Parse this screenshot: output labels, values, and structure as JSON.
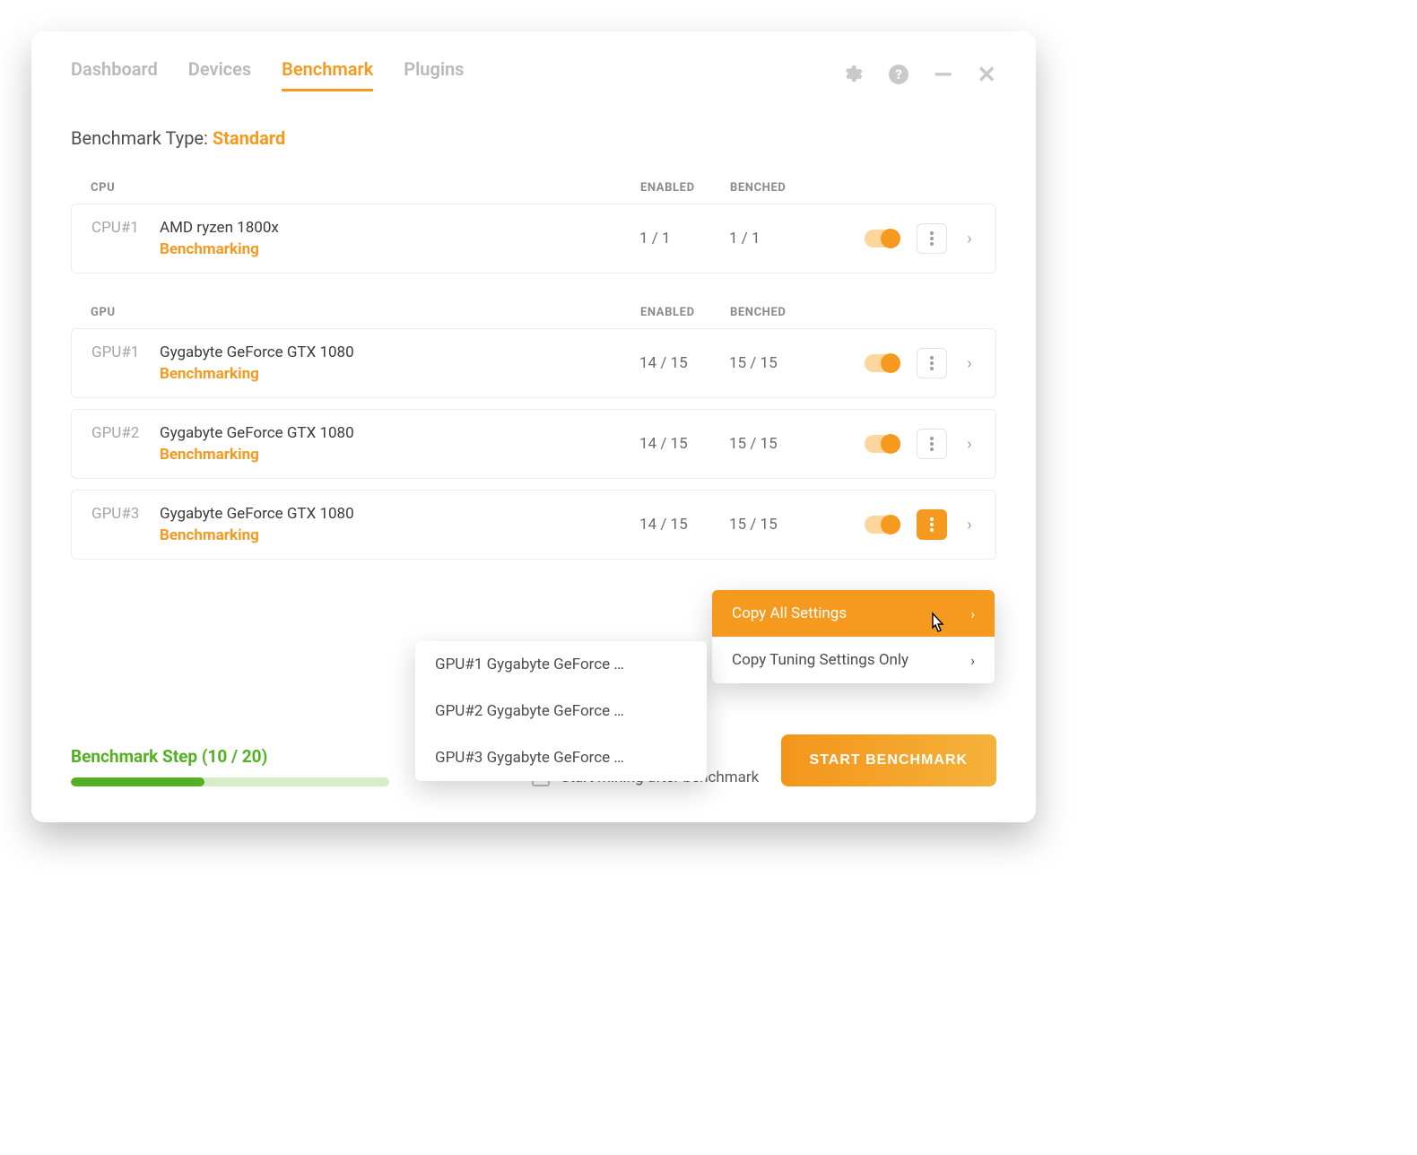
{
  "tabs": {
    "dashboard": "Dashboard",
    "devices": "Devices",
    "benchmark": "Benchmark",
    "plugins": "Plugins"
  },
  "bench_type": {
    "label": "Benchmark Type:",
    "value": "Standard"
  },
  "columns": {
    "enabled": "ENABLED",
    "benched": "BENCHED"
  },
  "cpu": {
    "header": "CPU",
    "rows": [
      {
        "id": "CPU#1",
        "name": "AMD ryzen 1800x",
        "state": "Benchmarking",
        "enabled": "1 / 1",
        "benched": "1 / 1"
      }
    ]
  },
  "gpu": {
    "header": "GPU",
    "rows": [
      {
        "id": "GPU#1",
        "name": "Gygabyte GeForce GTX 1080",
        "state": "Benchmarking",
        "enabled": "14 / 15",
        "benched": "15 / 15"
      },
      {
        "id": "GPU#2",
        "name": "Gygabyte GeForce GTX 1080",
        "state": "Benchmarking",
        "enabled": "14 / 15",
        "benched": "15 / 15"
      },
      {
        "id": "GPU#3",
        "name": "Gygabyte GeForce GTX 1080",
        "state": "Benchmarking",
        "enabled": "14 / 15",
        "benched": "15 / 15"
      }
    ]
  },
  "copy_menu": {
    "all": "Copy All Settings",
    "tuning": "Copy Tuning Settings Only"
  },
  "target_menu": {
    "t0": "GPU#1 Gygabyte GeForce …",
    "t1": "GPU#2 Gygabyte GeForce …",
    "t2": "GPU#3 Gygabyte GeForce …"
  },
  "footer": {
    "step_label": "Benchmark Step (10 / 20)",
    "progress_ratio": 0.5,
    "mine_label": "Start mining after benchmark",
    "start_label": "START BENCHMARK"
  }
}
